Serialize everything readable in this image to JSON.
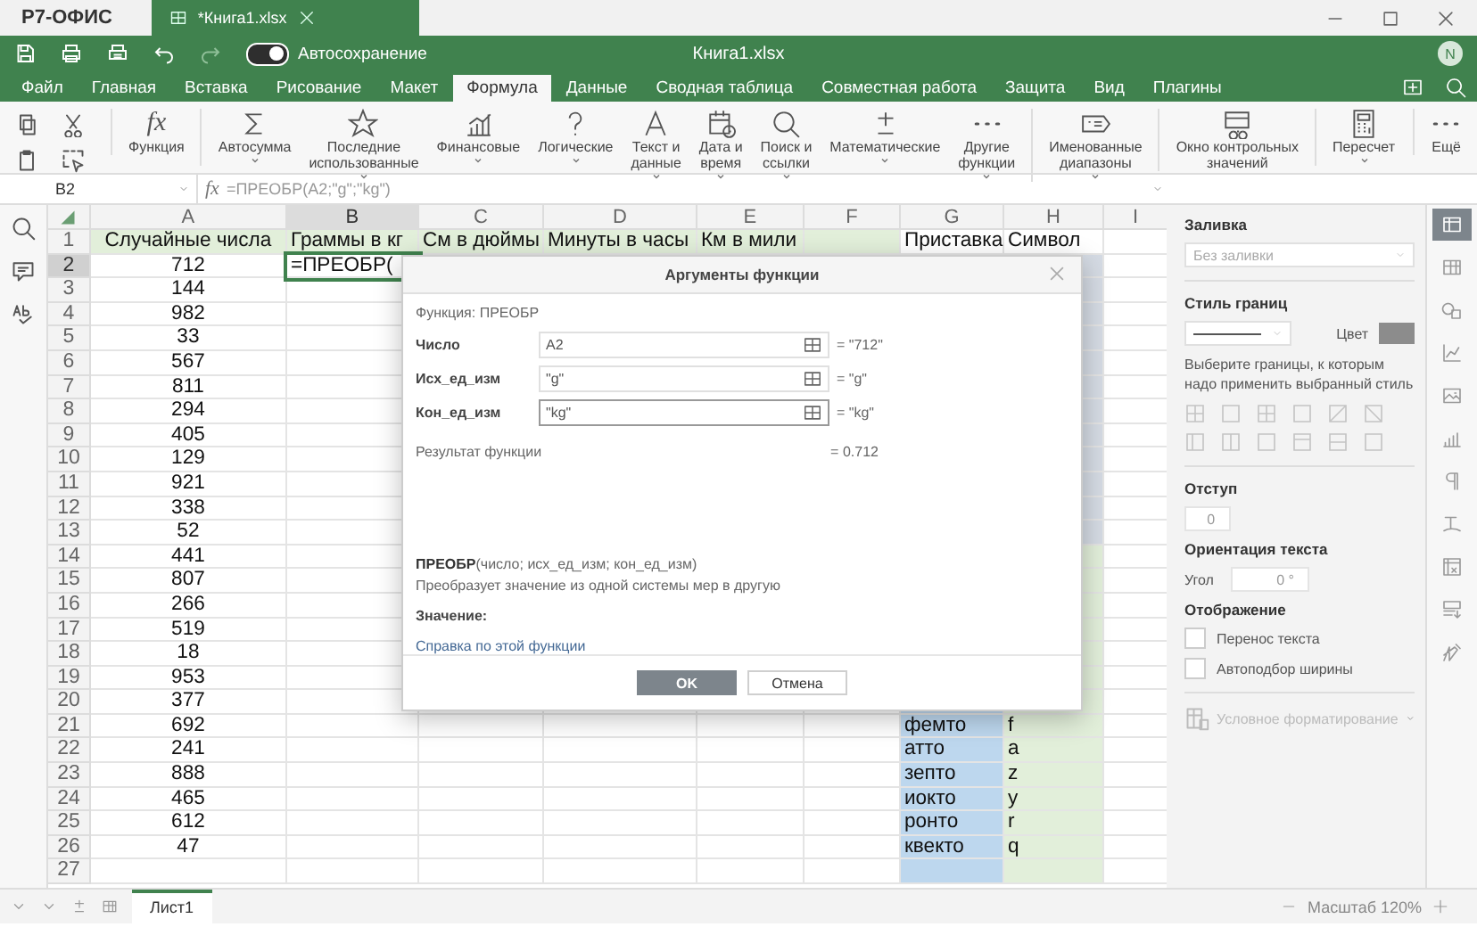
{
  "app_bar": {
    "brand": "Р7-ОФИС",
    "tabs": [
      {
        "label": "*Книга1.xlsx",
        "selected": true
      }
    ]
  },
  "header": {
    "quick_actions": [
      {
        "disabled": false
      },
      {
        "disabled": false
      },
      {
        "disabled": false
      },
      {
        "disabled": false
      },
      {
        "disabled": true
      }
    ],
    "autosave": {
      "label": "Автосохранение",
      "on": true
    },
    "title": "Книга1.xlsx",
    "avatar": "N"
  },
  "menu": [
    {
      "label": "Файл",
      "selected": false
    },
    {
      "label": "Главная",
      "selected": false
    },
    {
      "label": "Вставка",
      "selected": false
    },
    {
      "label": "Рисование",
      "selected": false
    },
    {
      "label": "Макет",
      "selected": false
    },
    {
      "label": "Формула",
      "selected": true
    },
    {
      "label": "Данные",
      "selected": false
    },
    {
      "label": "Сводная таблица",
      "selected": false
    },
    {
      "label": "Совместная работа",
      "selected": false
    },
    {
      "label": "Защита",
      "selected": false
    },
    {
      "label": "Вид",
      "selected": false
    },
    {
      "label": "Плагины",
      "selected": false
    }
  ],
  "toolbar": [
    {
      "glyph": "fx",
      "label": "Функция",
      "has_menu": false,
      "group_start": true
    },
    {
      "label": "Автосумма",
      "has_menu": true,
      "group_start": true
    },
    {
      "label": "Последние\nиспользованные",
      "has_menu": true,
      "group_start": false
    },
    {
      "label": "Финансовые",
      "has_menu": true,
      "group_start": false
    },
    {
      "label": "Логические",
      "has_menu": true,
      "group_start": false
    },
    {
      "label": "Текст и\nданные",
      "has_menu": true,
      "group_start": false
    },
    {
      "label": "Дата и\nвремя",
      "has_menu": true,
      "group_start": false
    },
    {
      "label": "Поиск и\nссылки",
      "has_menu": true,
      "group_start": false
    },
    {
      "label": "Математические",
      "has_menu": true,
      "group_start": false
    },
    {
      "label": "Другие\nфункции",
      "has_menu": true,
      "group_start": false
    },
    {
      "label": "Именованные\nдиапазоны",
      "has_menu": true,
      "group_start": true
    },
    {
      "label": "Окно контрольных\nзначений",
      "has_menu": false,
      "group_start": true
    },
    {
      "label": "Пересчет",
      "has_menu": true,
      "group_start": true
    }
  ],
  "toolbar_more": "Ещё",
  "formula_bar": {
    "cell": "B2",
    "fx": "fx",
    "formula": "=ПРЕОБР(A2;\"g\";\"kg\")"
  },
  "sheet": {
    "columns": [
      {
        "label": "A",
        "selected": false
      },
      {
        "label": "B",
        "selected": true
      },
      {
        "label": "C",
        "selected": false
      },
      {
        "label": "D",
        "selected": false
      },
      {
        "label": "E",
        "selected": false
      },
      {
        "label": "F",
        "selected": false
      },
      {
        "label": "G",
        "selected": false
      },
      {
        "label": "H",
        "selected": false
      },
      {
        "label": "I",
        "selected": false
      }
    ],
    "rows": [
      {
        "label": "1",
        "selected": false,
        "cells": {
          "A": "Случайные числа",
          "B": "Граммы в кг",
          "C": "См в дюймы",
          "D": "Минуты в часы",
          "E": "Км в мили",
          "G": "Приставка",
          "H": "Символ"
        }
      },
      {
        "label": "2",
        "selected": true,
        "cells": {
          "A": "712",
          "B": "=ПРЕОБР("
        }
      },
      {
        "label": "3",
        "selected": false,
        "cells": {
          "A": "144"
        }
      },
      {
        "label": "4",
        "selected": false,
        "cells": {
          "A": "982"
        }
      },
      {
        "label": "5",
        "selected": false,
        "cells": {
          "A": "33"
        }
      },
      {
        "label": "6",
        "selected": false,
        "cells": {
          "A": "567"
        }
      },
      {
        "label": "7",
        "selected": false,
        "cells": {
          "A": "811"
        }
      },
      {
        "label": "8",
        "selected": false,
        "cells": {
          "A": "294"
        }
      },
      {
        "label": "9",
        "selected": false,
        "cells": {
          "A": "405"
        }
      },
      {
        "label": "10",
        "selected": false,
        "cells": {
          "A": "129"
        }
      },
      {
        "label": "11",
        "selected": false,
        "cells": {
          "A": "921"
        }
      },
      {
        "label": "12",
        "selected": false,
        "cells": {
          "A": "338"
        }
      },
      {
        "label": "13",
        "selected": false,
        "cells": {
          "A": "52"
        }
      },
      {
        "label": "14",
        "selected": false,
        "cells": {
          "A": "441"
        }
      },
      {
        "label": "15",
        "selected": false,
        "cells": {
          "A": "807"
        }
      },
      {
        "label": "16",
        "selected": false,
        "cells": {
          "A": "266"
        }
      },
      {
        "label": "17",
        "selected": false,
        "cells": {
          "A": "519"
        }
      },
      {
        "label": "18",
        "selected": false,
        "cells": {
          "A": "18"
        }
      },
      {
        "label": "19",
        "selected": false,
        "cells": {
          "A": "953"
        }
      },
      {
        "label": "20",
        "selected": false,
        "cells": {
          "A": "377"
        }
      },
      {
        "label": "21",
        "selected": false,
        "cells": {
          "A": "692",
          "G": "фемто",
          "H": "f"
        }
      },
      {
        "label": "22",
        "selected": false,
        "cells": {
          "A": "241",
          "G": "атто",
          "H": "a"
        }
      },
      {
        "label": "23",
        "selected": false,
        "cells": {
          "A": "888",
          "G": "зепто",
          "H": "z"
        }
      },
      {
        "label": "24",
        "selected": false,
        "cells": {
          "A": "465",
          "G": "иокто",
          "H": "y"
        }
      },
      {
        "label": "25",
        "selected": false,
        "cells": {
          "A": "612",
          "G": "ронто",
          "H": "r"
        }
      },
      {
        "label": "26",
        "selected": false,
        "cells": {
          "A": "47",
          "G": "квекто",
          "H": "q"
        }
      },
      {
        "label": "27",
        "selected": false,
        "cells": {}
      }
    ]
  },
  "dialog": {
    "title": "Аргументы функции",
    "function_line": "Функция: ПРЕОБР",
    "arguments": [
      {
        "name": "Число",
        "value": "A2",
        "result": "= \"712\"",
        "focused": false
      },
      {
        "name": "Исх_ед_изм",
        "value": "\"g\"",
        "result": "= \"g\"",
        "focused": false
      },
      {
        "name": "Кон_ед_изм",
        "value": "\"kg\"",
        "result": "= \"kg\"",
        "focused": true
      }
    ],
    "result_label": "Результат функции",
    "result_value": "= 0.712",
    "syntax": "**ПРЕОБР**(число; исх_ед_изм; кон_ед_изм)",
    "description": "Преобразует значение из одной системы мер в другую",
    "value_label": "Значение:",
    "help_link": "Справка по этой функции",
    "buttons": [
      {
        "label": "OK",
        "kind": "primary"
      },
      {
        "label": "Отмена",
        "kind": "secondary"
      }
    ]
  },
  "format_panel": {
    "fill": {
      "title": "Заливка",
      "value": "Без заливки",
      "disabled": true
    },
    "border": {
      "title": "Стиль границ",
      "color_label": "Цвет",
      "hint": "Выберите границы, к которым надо применить выбранный стиль"
    },
    "indent": {
      "title": "Отступ",
      "value": "0"
    },
    "orientation": {
      "title": "Ориентация текста",
      "angle_label": "Угол",
      "value": "0 °"
    },
    "display": {
      "title": "Отображение",
      "options": [
        {
          "label": "Перенос текста",
          "checked": false
        },
        {
          "label": "Автоподбор ширины",
          "checked": false
        }
      ]
    },
    "conditional": {
      "label": "Условное форматирование",
      "disabled": true
    }
  },
  "side_tabs": [
    {
      "selected": true
    },
    {
      "selected": false
    },
    {
      "selected": false
    },
    {
      "selected": false
    },
    {
      "selected": false
    },
    {
      "selected": false
    },
    {
      "selected": false
    },
    {
      "selected": false
    },
    {
      "selected": false
    },
    {
      "selected": false
    },
    {
      "selected": false
    }
  ],
  "sheet_tabs": [
    {
      "label": "Лист1",
      "selected": true
    }
  ],
  "zoom": "Масштаб 120%"
}
